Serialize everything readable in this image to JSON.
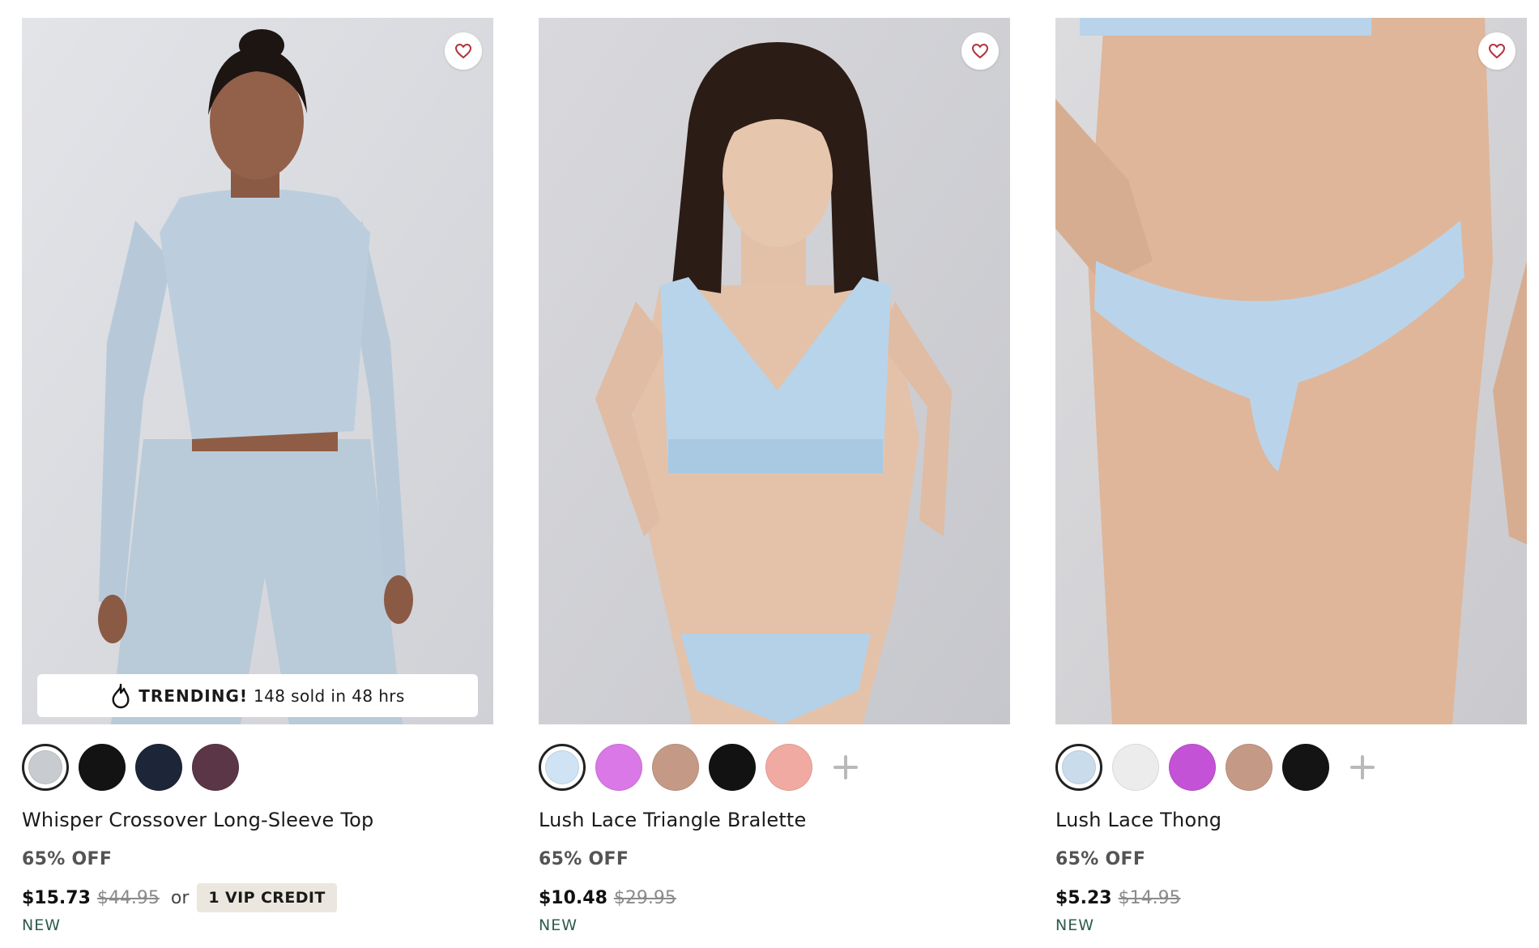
{
  "products": [
    {
      "name": "Whisper Crossover Long-Sleeve Top",
      "discount": "65% OFF",
      "price": "$15.73",
      "original_price": "$44.95",
      "or_text": "or",
      "vip_credit": "1 VIP CREDIT",
      "badge": "NEW",
      "trending": {
        "label": "TRENDING!",
        "text": "148 sold in 48 hrs"
      },
      "swatches": [
        "#c8ccd0",
        "#131313",
        "#1c2638",
        "#5a3646"
      ],
      "selected_swatch": 0,
      "more_colors": false,
      "icons": {
        "favorite": "heart-icon",
        "trending": "flame-icon"
      }
    },
    {
      "name": "Lush Lace Triangle Bralette",
      "discount": "65% OFF",
      "price": "$10.48",
      "original_price": "$29.95",
      "badge": "NEW",
      "swatches": [
        "#cfe3f4",
        "#d978e6",
        "#c49a86",
        "#121212",
        "#f0aaa2"
      ],
      "selected_swatch": 0,
      "more_colors": true,
      "icons": {
        "favorite": "heart-icon",
        "more": "plus-icon"
      }
    },
    {
      "name": "Lush Lace Thong",
      "discount": "65% OFF",
      "price": "$5.23",
      "original_price": "$14.95",
      "badge": "NEW",
      "swatches": [
        "#c9dcec",
        "#ececec",
        "#c452d6",
        "#c49a86",
        "#141414"
      ],
      "selected_swatch": 0,
      "more_colors": true,
      "icons": {
        "favorite": "heart-icon",
        "more": "plus-icon"
      }
    }
  ],
  "colors": {
    "heart": "#b2323a",
    "badge_new": "#2e5c4f",
    "vip_background": "#ebe7df",
    "strikethrough": "#8b8b8b"
  }
}
